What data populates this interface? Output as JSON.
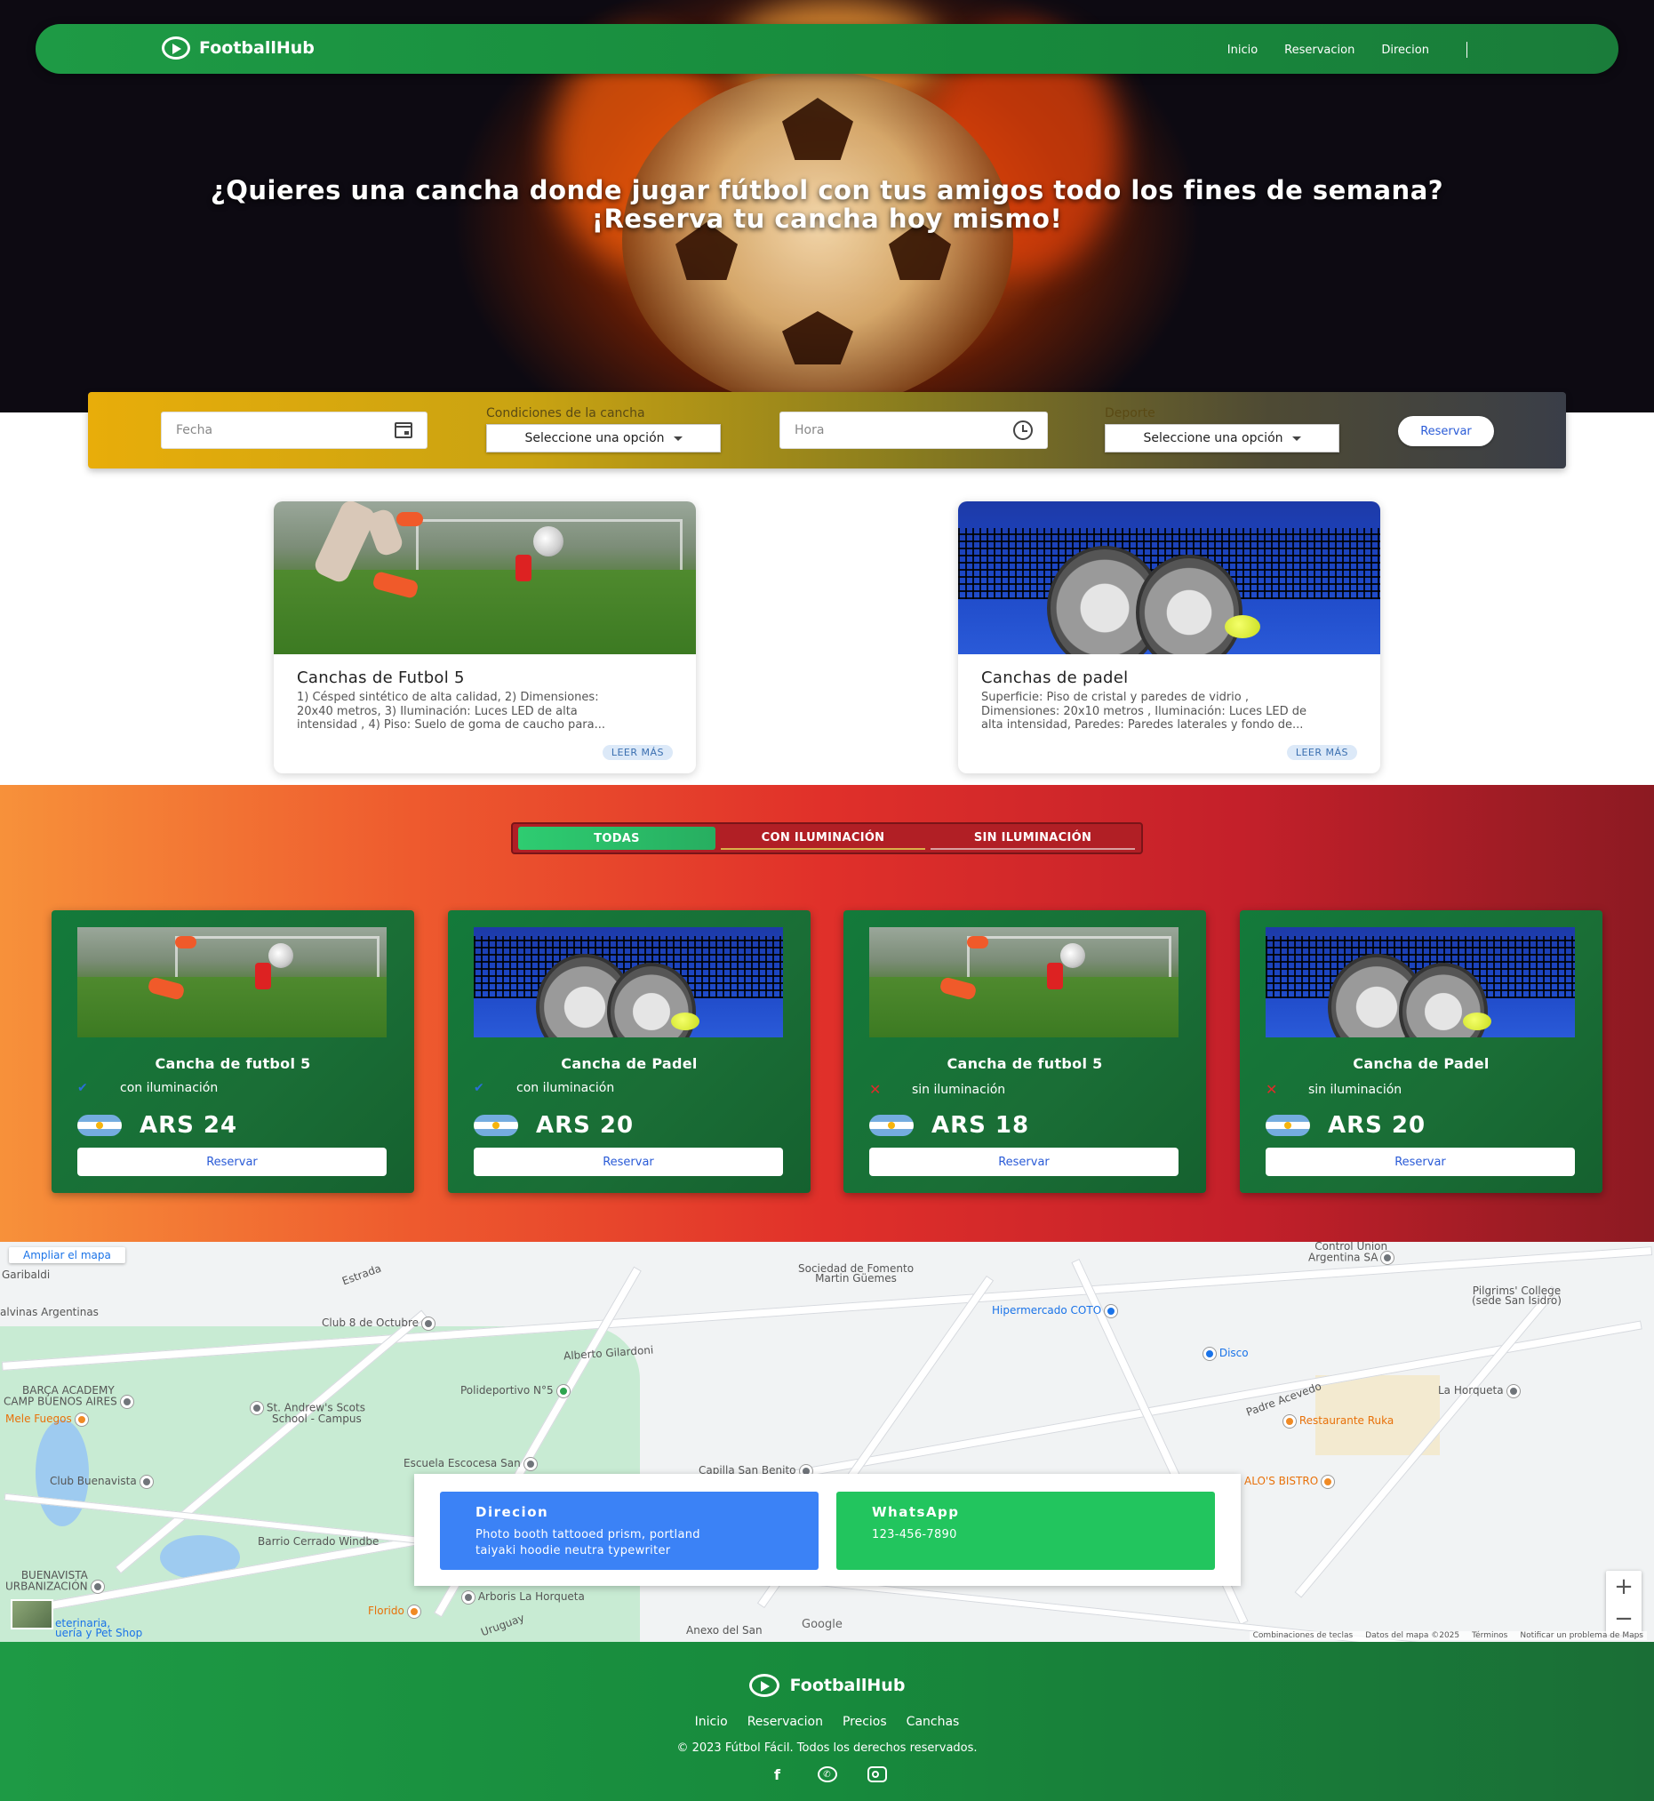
{
  "brand": {
    "name": "FootballHub",
    "logo_icon": "play-circle-icon"
  },
  "nav": {
    "links": [
      "Inicio",
      "Reservacion",
      "Direcion"
    ]
  },
  "hero": {
    "line1": "¿Quieres una cancha donde jugar fútbol con tus amigos todo los fines de semana?",
    "line2": "¡Reserva tu cancha hoy mismo!"
  },
  "booking": {
    "date_placeholder": "Fecha",
    "conditions_label": "Condiciones de la cancha",
    "conditions_value": "Seleccione una opción",
    "time_placeholder": "Hora",
    "sport_label": "Deporte",
    "sport_value": "Seleccione una opción",
    "button": "Reservar"
  },
  "features": [
    {
      "title": "Canchas de Futbol 5",
      "desc_lines": [
        "1) Césped sintético de alta calidad, 2) Dimensiones:",
        "20x40 metros, 3) Iluminación: Luces LED de alta",
        "intensidad , 4) Piso: Suelo de goma de caucho para..."
      ],
      "more": "LEER MÁS"
    },
    {
      "title": "Canchas de padel",
      "desc_lines": [
        "Superficie: Piso de cristal y paredes de vidrio ,",
        "Dimensiones: 20x10 metros , Iluminación: Luces LED de",
        "alta intensidad, Paredes: Paredes laterales y fondo de..."
      ],
      "more": "LEER MÁS"
    }
  ],
  "tabs": [
    "TODAS",
    "CON ILUMINACIÓN",
    "SIN ILUMINACIÓN"
  ],
  "courts": [
    {
      "title": "Cancha de futbol 5",
      "feature": "con iluminación",
      "lit": true,
      "price": "ARS 24",
      "button": "Reservar",
      "image": "soccer"
    },
    {
      "title": "Cancha de Padel",
      "feature": "con iluminación",
      "lit": true,
      "price": "ARS 20",
      "button": "Reservar",
      "image": "padel"
    },
    {
      "title": "Cancha de futbol 5",
      "feature": "sin iluminación",
      "lit": false,
      "price": "ARS 18",
      "button": "Reservar",
      "image": "soccer"
    },
    {
      "title": "Cancha de Padel",
      "feature": "sin iluminación",
      "lit": false,
      "price": "ARS 20",
      "button": "Reservar",
      "image": "padel"
    }
  ],
  "map": {
    "enlarge": "Ampliar el mapa",
    "labels": {
      "garibaldi": "Garibaldi",
      "malvinas": "alvinas Argentinas",
      "estrada": "Estrada",
      "sociedad1": "Sociedad de Fomento",
      "sociedad2": "Martin Güemes",
      "control1": "Control Union",
      "control2": "Argentina SA",
      "pilgrims1": "Pilgrims' College",
      "pilgrims2": "(sede San Isidro)",
      "club8": "Club 8 de Octubre",
      "hipermercado": "Hipermercado COTO",
      "disco": "Disco",
      "alberto": "Alberto Gilardoni",
      "barca1": "BARÇA ACADEMY",
      "barca2": "CAMP BUENOS AIRES",
      "mele": "Mele Fuegos",
      "standrews1": "St. Andrew's Scots",
      "standrews2": "School - Campus",
      "polideportivo": "Polideportivo N°5",
      "horqueta": "La Horqueta",
      "ruka": "Restaurante Ruka",
      "escocesa": "Escuela Escocesa San",
      "capilla": "Capilla San Benito",
      "buenavista": "Club Buenavista",
      "barrio": "Barrio Cerrado Windbe",
      "bistro": "ALO'S BISTRO",
      "buenavista_urb1": "BUENAVISTA",
      "buenavista_urb2": "URBANIZACIÓN",
      "arboris": "Arboris La Horqueta",
      "florido": "Florido",
      "veterinaria": "eterinaria,",
      "petshop": "uería y Pet Shop",
      "anexo": "Anexo del San",
      "uruguay": "Uruguay",
      "padre": "Padre Acevedo"
    },
    "google": "Google",
    "footer_links": [
      "Combinaciones de teclas",
      "Datos del mapa ©2025",
      "Términos",
      "Notificar un problema de Maps"
    ],
    "zoom_in": "+",
    "zoom_out": "−"
  },
  "contact": {
    "address_title": "Direcion",
    "address_line1": "Photo booth tattooed prism, portland",
    "address_line2": "taiyaki hoodie neutra typewriter",
    "whatsapp_title": "WhatsApp",
    "whatsapp_number": "123-456-7890"
  },
  "footer": {
    "brand": "FootballHub",
    "links": [
      "Inicio",
      "Reservacion",
      "Precios",
      "Canchas"
    ],
    "copyright": "© 2023 Fútbol Fácil. Todos los derechos reservados.",
    "social_icons": [
      "facebook-icon",
      "whatsapp-icon",
      "instagram-icon"
    ]
  }
}
